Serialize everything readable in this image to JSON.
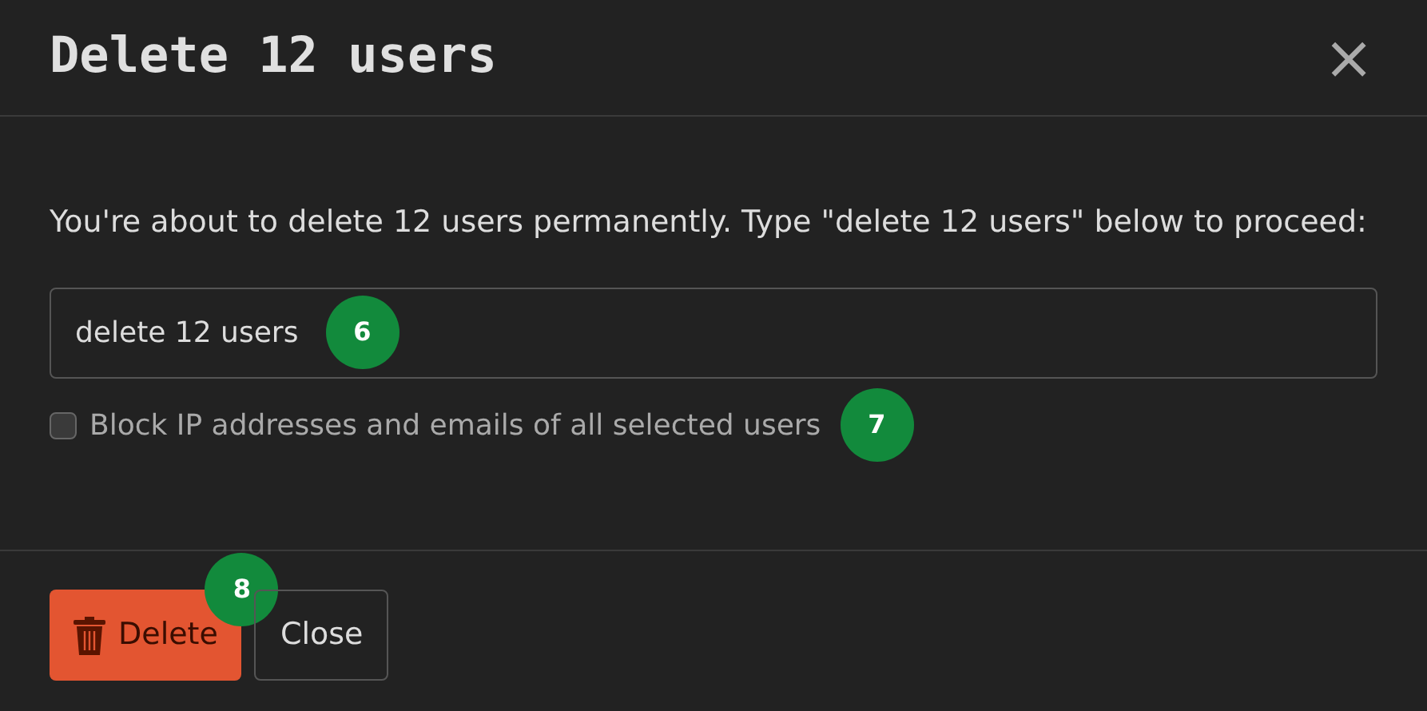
{
  "dialog": {
    "title": "Delete 12 users",
    "close_icon": "×"
  },
  "message": "You're about to delete 12 users permanently. Type \"delete 12 users\" below to proceed:",
  "confirm_field": {
    "value": "delete 12 users",
    "marker": "6"
  },
  "block_option": {
    "label": "Block IP addresses and emails of all selected users",
    "checked": false,
    "marker": "7"
  },
  "buttons": [
    {
      "kind": "danger",
      "label": "Delete",
      "marker": "8"
    },
    {
      "kind": "secondary",
      "label": "Close"
    }
  ]
}
